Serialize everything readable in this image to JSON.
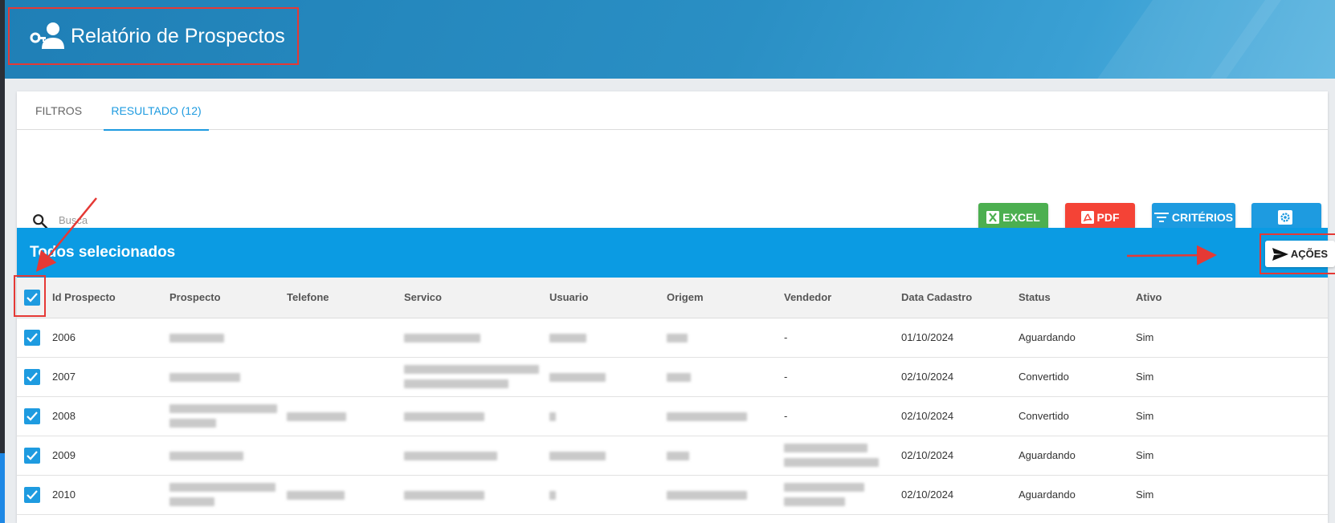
{
  "header": {
    "title": "Relatório de Prospectos",
    "icon": "user-key-icon"
  },
  "tabs": [
    {
      "label": "FILTROS",
      "active": false
    },
    {
      "label": "RESULTADO (12)",
      "active": true
    }
  ],
  "search": {
    "placeholder": "Busca",
    "value": ""
  },
  "toolbar": {
    "excel_label": "EXCEL",
    "pdf_label": "PDF",
    "criterios_label": "CRITÉRIOS",
    "settings_icon": "gear-icon"
  },
  "selection": {
    "text": "Todos selecionados",
    "acoes_label": "AÇÕES"
  },
  "table": {
    "columns": [
      "Id Prospecto",
      "Prospecto",
      "Telefone",
      "Servico",
      "Usuario",
      "Origem",
      "Vendedor",
      "Data Cadastro",
      "Status",
      "Ativo"
    ],
    "rows": [
      {
        "id": "2006",
        "vendedor": "-",
        "data": "01/10/2024",
        "status": "Aguardando",
        "ativo": "Sim"
      },
      {
        "id": "2007",
        "vendedor": "-",
        "data": "02/10/2024",
        "status": "Convertido",
        "ativo": "Sim"
      },
      {
        "id": "2008",
        "vendedor": "-",
        "data": "02/10/2024",
        "status": "Convertido",
        "ativo": "Sim"
      },
      {
        "id": "2009",
        "vendedor": "",
        "data": "02/10/2024",
        "status": "Aguardando",
        "ativo": "Sim"
      },
      {
        "id": "2010",
        "vendedor": "",
        "data": "02/10/2024",
        "status": "Aguardando",
        "ativo": "Sim"
      }
    ]
  },
  "colors": {
    "header_blue": "#2a8fc4",
    "accent": "#0b9be3",
    "excel": "#4caf50",
    "pdf": "#f44336",
    "annotation_red": "#e53935"
  }
}
